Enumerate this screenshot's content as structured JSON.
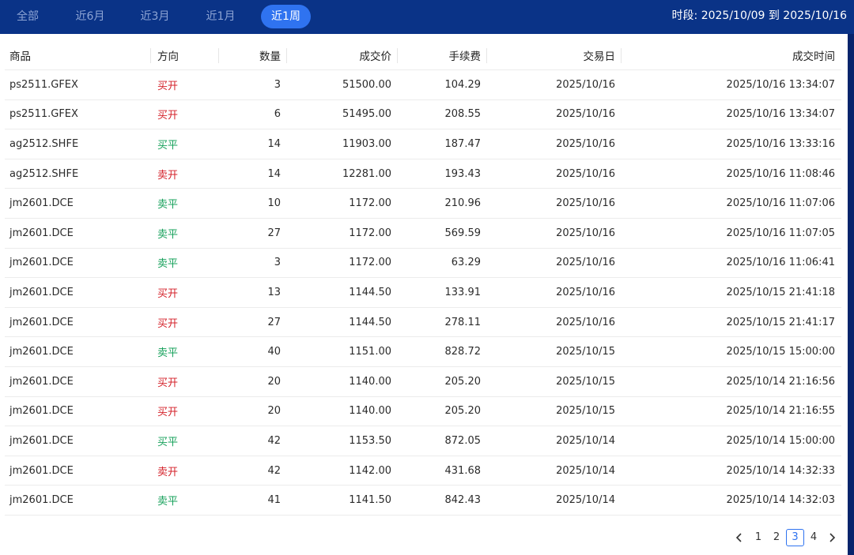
{
  "tabs": [
    {
      "label": "全部"
    },
    {
      "label": "近6月"
    },
    {
      "label": "近3月"
    },
    {
      "label": "近1月"
    },
    {
      "label": "近1周"
    }
  ],
  "active_tab": 4,
  "period": "时段: 2025/10/09 到 2025/10/16",
  "table": {
    "headers": {
      "name": "商品",
      "dir": "方向",
      "qty": "数量",
      "price": "成交价",
      "fee": "手续费",
      "day": "交易日",
      "time": "成交时间"
    },
    "rows": [
      {
        "name": "ps2511.GFEX",
        "dir": "买开",
        "qty": "3",
        "price": "51500.00",
        "fee": "104.29",
        "day": "2025/10/16",
        "time": "2025/10/16 13:34:07"
      },
      {
        "name": "ps2511.GFEX",
        "dir": "买开",
        "qty": "6",
        "price": "51495.00",
        "fee": "208.55",
        "day": "2025/10/16",
        "time": "2025/10/16 13:34:07"
      },
      {
        "name": "ag2512.SHFE",
        "dir": "买平",
        "qty": "14",
        "price": "11903.00",
        "fee": "187.47",
        "day": "2025/10/16",
        "time": "2025/10/16 13:33:16"
      },
      {
        "name": "ag2512.SHFE",
        "dir": "卖开",
        "qty": "14",
        "price": "12281.00",
        "fee": "193.43",
        "day": "2025/10/16",
        "time": "2025/10/16 11:08:46"
      },
      {
        "name": "jm2601.DCE",
        "dir": "卖平",
        "qty": "10",
        "price": "1172.00",
        "fee": "210.96",
        "day": "2025/10/16",
        "time": "2025/10/16 11:07:06"
      },
      {
        "name": "jm2601.DCE",
        "dir": "卖平",
        "qty": "27",
        "price": "1172.00",
        "fee": "569.59",
        "day": "2025/10/16",
        "time": "2025/10/16 11:07:05"
      },
      {
        "name": "jm2601.DCE",
        "dir": "卖平",
        "qty": "3",
        "price": "1172.00",
        "fee": "63.29",
        "day": "2025/10/16",
        "time": "2025/10/16 11:06:41"
      },
      {
        "name": "jm2601.DCE",
        "dir": "买开",
        "qty": "13",
        "price": "1144.50",
        "fee": "133.91",
        "day": "2025/10/16",
        "time": "2025/10/15 21:41:18"
      },
      {
        "name": "jm2601.DCE",
        "dir": "买开",
        "qty": "27",
        "price": "1144.50",
        "fee": "278.11",
        "day": "2025/10/16",
        "time": "2025/10/15 21:41:17"
      },
      {
        "name": "jm2601.DCE",
        "dir": "卖平",
        "qty": "40",
        "price": "1151.00",
        "fee": "828.72",
        "day": "2025/10/15",
        "time": "2025/10/15 15:00:00"
      },
      {
        "name": "jm2601.DCE",
        "dir": "买开",
        "qty": "20",
        "price": "1140.00",
        "fee": "205.20",
        "day": "2025/10/15",
        "time": "2025/10/14 21:16:56"
      },
      {
        "name": "jm2601.DCE",
        "dir": "买开",
        "qty": "20",
        "price": "1140.00",
        "fee": "205.20",
        "day": "2025/10/15",
        "time": "2025/10/14 21:16:55"
      },
      {
        "name": "jm2601.DCE",
        "dir": "买平",
        "qty": "42",
        "price": "1153.50",
        "fee": "872.05",
        "day": "2025/10/14",
        "time": "2025/10/14 15:00:00"
      },
      {
        "name": "jm2601.DCE",
        "dir": "卖开",
        "qty": "42",
        "price": "1142.00",
        "fee": "431.68",
        "day": "2025/10/14",
        "time": "2025/10/14 14:32:33"
      },
      {
        "name": "jm2601.DCE",
        "dir": "卖平",
        "qty": "41",
        "price": "1141.50",
        "fee": "842.43",
        "day": "2025/10/14",
        "time": "2025/10/14 14:32:03"
      }
    ]
  },
  "direction_colors": {
    "买开": "#d4222a",
    "卖开": "#d4222a",
    "买平": "#15a05a",
    "卖平": "#15a05a"
  },
  "pagination": {
    "pages": [
      "1",
      "2",
      "3",
      "4"
    ],
    "current": "3",
    "prev_icon": "chevron-left-icon",
    "next_icon": "chevron-right-icon"
  },
  "colors": {
    "topbar": "#0a3387",
    "accent": "#2f73f0"
  }
}
